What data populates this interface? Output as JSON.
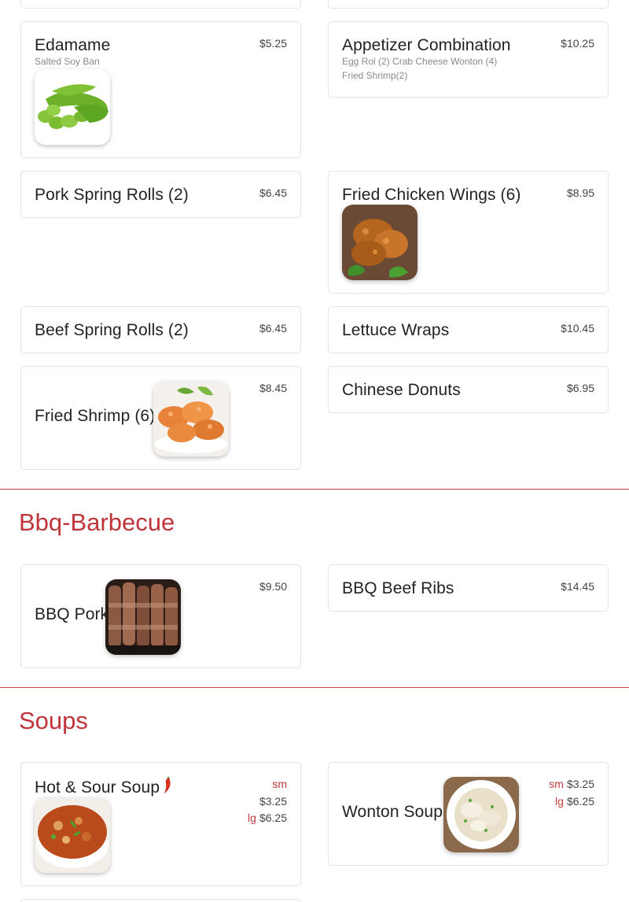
{
  "colors": {
    "accent": "#c0343b",
    "rule": "#c9434a",
    "size_label": "#c23b3b"
  },
  "appetizers": {
    "edamame": {
      "name": "Edamame",
      "price": "$5.25",
      "desc": "Salted Soy Ban",
      "image": "edamame-photo"
    },
    "appetizer_combination": {
      "name": "Appetizer Combination",
      "price": "$10.25",
      "desc_line1": "Egg Rol (2) Crab Cheese Wonton (4)",
      "desc_line2": "Fried Shrimp(2)"
    },
    "pork_spring_rolls": {
      "name": "Pork Spring Rolls (2)",
      "price": "$6.45"
    },
    "fried_chicken_wings": {
      "name": "Fried Chicken Wings (6)",
      "price": "$8.95",
      "image": "chicken-wings-photo"
    },
    "beef_spring_rolls": {
      "name": "Beef Spring Rolls (2)",
      "price": "$6.45"
    },
    "lettuce_wraps": {
      "name": "Lettuce Wraps",
      "price": "$10.45"
    },
    "fried_shrimp": {
      "name": "Fried Shrimp (6)",
      "price": "$8.45",
      "image": "fried-shrimp-photo"
    },
    "chinese_donuts": {
      "name": "Chinese Donuts",
      "price": "$6.95"
    }
  },
  "bbq": {
    "title": "Bbq-Barbecue",
    "bbq_pork": {
      "name": "BBQ Pork",
      "price": "$9.50",
      "image": "bbq-pork-photo"
    },
    "bbq_beef_ribs": {
      "name": "BBQ Beef Ribs",
      "price": "$14.45"
    }
  },
  "soups": {
    "title": "Soups",
    "hot_sour_soup": {
      "name": "Hot & Sour Soup",
      "spicy_icon": "chili-pepper-icon",
      "sm_label": "sm",
      "sm_price": "$3.25",
      "lg_label": "lg",
      "lg_price": "$6.25",
      "image": "hot-sour-soup-photo"
    },
    "wonton_soup": {
      "name": "Wonton Soup",
      "sm_label": "sm",
      "sm_price": "$3.25",
      "lg_label": "lg",
      "lg_price": "$6.25",
      "image": "wonton-soup-photo"
    }
  }
}
